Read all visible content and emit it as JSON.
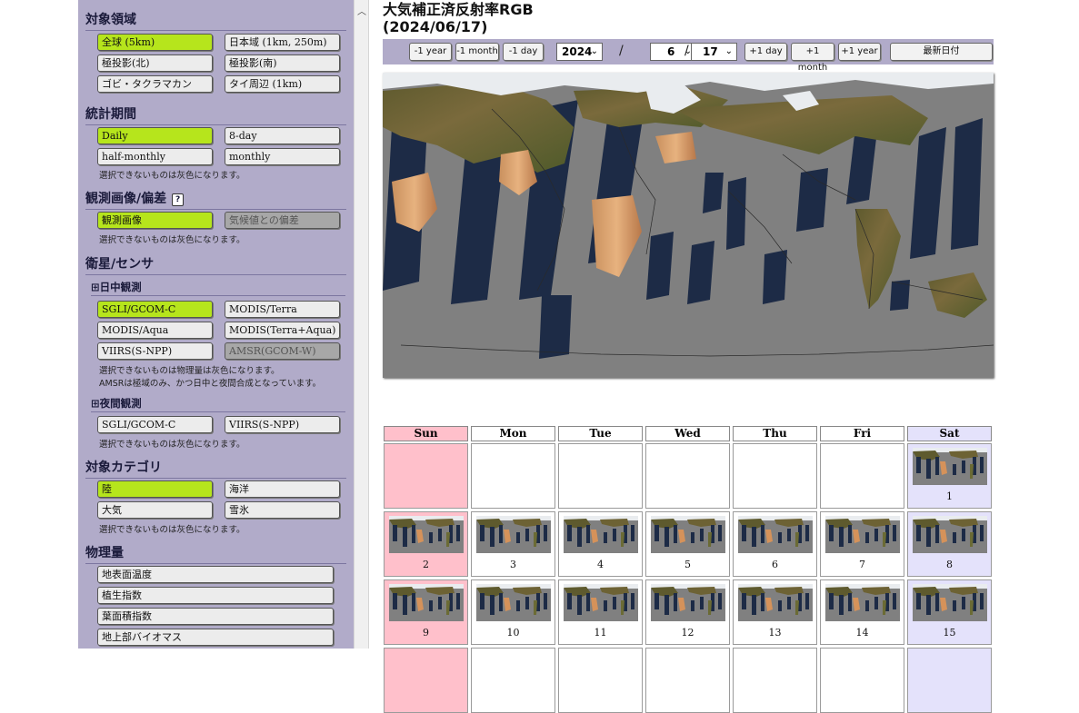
{
  "sidebar": {
    "target_area": {
      "heading": "対象領域",
      "options": [
        "全球 (5km)",
        "日本域 (1km, 250m)",
        "極投影(北)",
        "極投影(南)",
        "ゴビ・タクラマカン",
        "タイ周辺 (1km)"
      ]
    },
    "period": {
      "heading": "統計期間",
      "options": [
        "Daily",
        "8-day",
        "half-monthly",
        "monthly"
      ],
      "note": "選択できないものは灰色になります。"
    },
    "obs_image": {
      "heading": "観測画像/偏差",
      "help": "?",
      "options": [
        "観測画像",
        "気候値との偏差"
      ],
      "note": "選択できないものは灰色になります。"
    },
    "satellite": {
      "heading": "衛星/センサ",
      "day_heading": "日中観測",
      "day_options": [
        "SGLI/GCOM-C",
        "MODIS/Terra",
        "MODIS/Aqua",
        "MODIS(Terra+Aqua)",
        "VIIRS(S-NPP)",
        "AMSR(GCOM-W)"
      ],
      "day_note1": "選択できないものは物理量は灰色になります。",
      "day_note2": "AMSRは極域のみ、かつ日中と夜間合成となっています。",
      "night_heading": "夜間観測",
      "night_options": [
        "SGLI/GCOM-C",
        "VIIRS(S-NPP)"
      ],
      "night_note": "選択できないものは灰色になります。"
    },
    "category": {
      "heading": "対象カテゴリ",
      "options": [
        "陸",
        "海洋",
        "大気",
        "雪氷"
      ],
      "note": "選択できないものは灰色になります。"
    },
    "physical": {
      "heading": "物理量",
      "options": [
        "地表面温度",
        "植生指数",
        "葉面積指数",
        "地上部バイオマス"
      ]
    }
  },
  "main": {
    "title_line1": "大気補正済反射率RGB",
    "title_line2": "(2024/06/17)",
    "toolbar": {
      "minus_year": "-1 year",
      "minus_month": "-1 month",
      "minus_day": "-1 day",
      "year": "2024",
      "sep1": "/",
      "month": "6",
      "sep2": "/",
      "day": "17",
      "plus_day": "+1 day",
      "plus_month": "+1 month",
      "plus_year": "+1 year",
      "latest": "最新日付"
    }
  },
  "calendar": {
    "weekdays": [
      "Sun",
      "Mon",
      "Tue",
      "Wed",
      "Thu",
      "Fri",
      "Sat"
    ],
    "week1": [
      "",
      "",
      "",
      "",
      "",
      "",
      "1"
    ],
    "week2": [
      "2",
      "3",
      "4",
      "5",
      "6",
      "7",
      "8"
    ],
    "week3": [
      "9",
      "10",
      "11",
      "12",
      "13",
      "14",
      "15"
    ]
  },
  "colors": {
    "panel": "#b1abc9",
    "selected": "#b6e51c",
    "sunday": "#ffc0cb",
    "saturday": "#e4e2fb"
  }
}
